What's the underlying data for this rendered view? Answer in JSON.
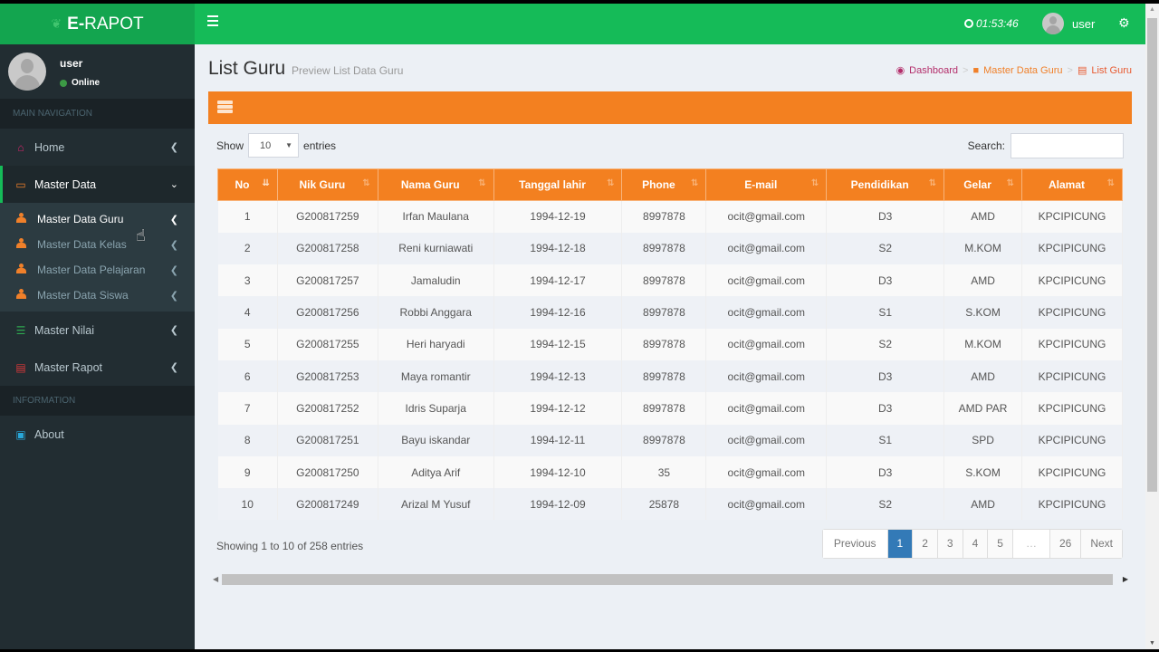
{
  "app": {
    "logo_prefix": "E-",
    "logo_name": "RAPOT",
    "clock": "01:53:46",
    "user": "user"
  },
  "sidebar": {
    "user_name": "user",
    "status": "Online",
    "header_main": "MAIN NAVIGATION",
    "header_info": "INFORMATION",
    "items": [
      {
        "label": "Home"
      },
      {
        "label": "Master Data"
      },
      {
        "label": "Master Nilai"
      },
      {
        "label": "Master Rapot"
      },
      {
        "label": "About"
      }
    ],
    "submenu": [
      {
        "label": "Master Data Guru"
      },
      {
        "label": "Master Data Kelas"
      },
      {
        "label": "Master Data Pelajaran"
      },
      {
        "label": "Master Data Siswa"
      }
    ]
  },
  "page": {
    "title": "List Guru",
    "subtitle": "Preview List Data Guru",
    "breadcrumb": [
      "Dashboard",
      "Master Data Guru",
      "List Guru"
    ]
  },
  "table_controls": {
    "show_label": "Show",
    "entries_label": "entries",
    "page_size": "10",
    "search_label": "Search:",
    "search_value": ""
  },
  "table": {
    "columns": [
      "No",
      "Nik Guru",
      "Nama Guru",
      "Tanggal lahir",
      "Phone",
      "E-mail",
      "Pendidikan",
      "Gelar",
      "Alamat"
    ],
    "rows": [
      [
        "1",
        "G200817259",
        "Irfan Maulana",
        "1994-12-19",
        "8997878",
        "ocit@gmail.com",
        "D3",
        "AMD",
        "KPCIPICUNG"
      ],
      [
        "2",
        "G200817258",
        "Reni kurniawati",
        "1994-12-18",
        "8997878",
        "ocit@gmail.com",
        "S2",
        "M.KOM",
        "KPCIPICUNG"
      ],
      [
        "3",
        "G200817257",
        "Jamaludin",
        "1994-12-17",
        "8997878",
        "ocit@gmail.com",
        "D3",
        "AMD",
        "KPCIPICUNG"
      ],
      [
        "4",
        "G200817256",
        "Robbi Anggara",
        "1994-12-16",
        "8997878",
        "ocit@gmail.com",
        "S1",
        "S.KOM",
        "KPCIPICUNG"
      ],
      [
        "5",
        "G200817255",
        "Heri haryadi",
        "1994-12-15",
        "8997878",
        "ocit@gmail.com",
        "S2",
        "M.KOM",
        "KPCIPICUNG"
      ],
      [
        "6",
        "G200817253",
        "Maya romantir",
        "1994-12-13",
        "8997878",
        "ocit@gmail.com",
        "D3",
        "AMD",
        "KPCIPICUNG"
      ],
      [
        "7",
        "G200817252",
        "Idris Suparja",
        "1994-12-12",
        "8997878",
        "ocit@gmail.com",
        "D3",
        "AMD PAR",
        "KPCIPICUNG"
      ],
      [
        "8",
        "G200817251",
        "Bayu iskandar",
        "1994-12-11",
        "8997878",
        "ocit@gmail.com",
        "S1",
        "SPD",
        "KPCIPICUNG"
      ],
      [
        "9",
        "G200817250",
        "Aditya Arif",
        "1994-12-10",
        "35",
        "ocit@gmail.com",
        "D3",
        "S.KOM",
        "KPCIPICUNG"
      ],
      [
        "10",
        "G200817249",
        "Arizal M Yusuf",
        "1994-12-09",
        "25878",
        "ocit@gmail.com",
        "S2",
        "AMD",
        "KPCIPICUNG"
      ]
    ]
  },
  "footer": {
    "info": "Showing 1 to 10 of 258 entries",
    "pagination": [
      "Previous",
      "1",
      "2",
      "3",
      "4",
      "5",
      "…",
      "26",
      "Next"
    ],
    "active_page": "1"
  },
  "colors": {
    "header_green": "#15bb58",
    "logo_green": "#13a54f",
    "accent_orange": "#f38020",
    "sidebar_bg": "#222d32",
    "pagination_active": "#337ab7"
  }
}
